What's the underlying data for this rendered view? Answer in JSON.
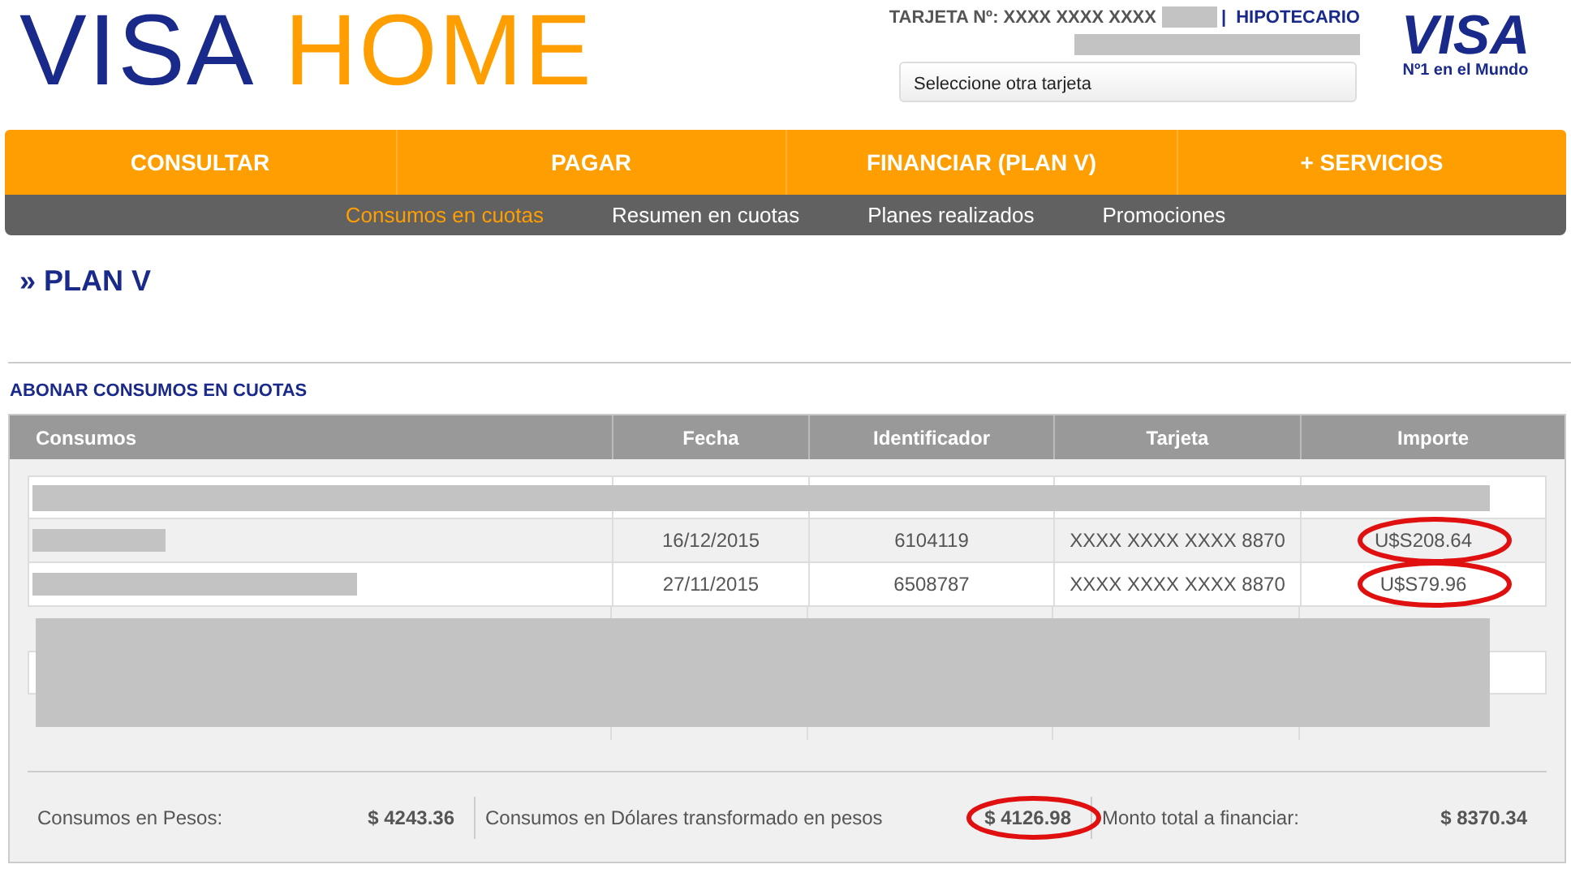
{
  "header": {
    "logo_left": "VISA",
    "logo_right": "HOME",
    "card_label": "TARJETA Nº: XXXX XXXX XXXX",
    "card_separator": "|",
    "card_type": "HIPOTECARIO",
    "card_select": "Seleccione otra tarjeta",
    "brand": "VISA",
    "brand_tagline": "Nº1 en el Mundo"
  },
  "nav": [
    {
      "label": "CONSULTAR"
    },
    {
      "label": "PAGAR"
    },
    {
      "label": "FINANCIAR (PLAN V)"
    },
    {
      "label": "+ SERVICIOS"
    }
  ],
  "subnav": [
    {
      "label": "Consumos en cuotas",
      "selected": true
    },
    {
      "label": "Resumen en cuotas",
      "selected": false
    },
    {
      "label": "Planes realizados",
      "selected": false
    },
    {
      "label": "Promociones",
      "selected": false
    }
  ],
  "page_title": "» PLAN V",
  "section_title": "ABONAR CONSUMOS EN CUOTAS",
  "table": {
    "columns": [
      "Consumos",
      "Fecha",
      "Identificador",
      "Tarjeta",
      "Importe"
    ],
    "rows": [
      {
        "kind": "redacted"
      },
      {
        "kind": "data",
        "fecha": "16/12/2015",
        "identificador": "6104119",
        "tarjeta": "XXXX XXXX XXXX 8870",
        "importe": "U$S208.64",
        "circled": true
      },
      {
        "kind": "data",
        "fecha": "27/11/2015",
        "identificador": "6508787",
        "tarjeta": "XXXX XXXX XXXX 8870",
        "importe": "U$S79.96",
        "circled": true
      },
      {
        "kind": "hidden"
      }
    ]
  },
  "totals": [
    {
      "label": "Consumos en Pesos:",
      "value": "$ 4243.36",
      "circled": false
    },
    {
      "label": "Consumos en Dólares transformado en pesos",
      "value": "$ 4126.98",
      "circled": true
    },
    {
      "label": "Monto total a financiar:",
      "value": "$ 8370.34",
      "circled": false
    }
  ]
}
